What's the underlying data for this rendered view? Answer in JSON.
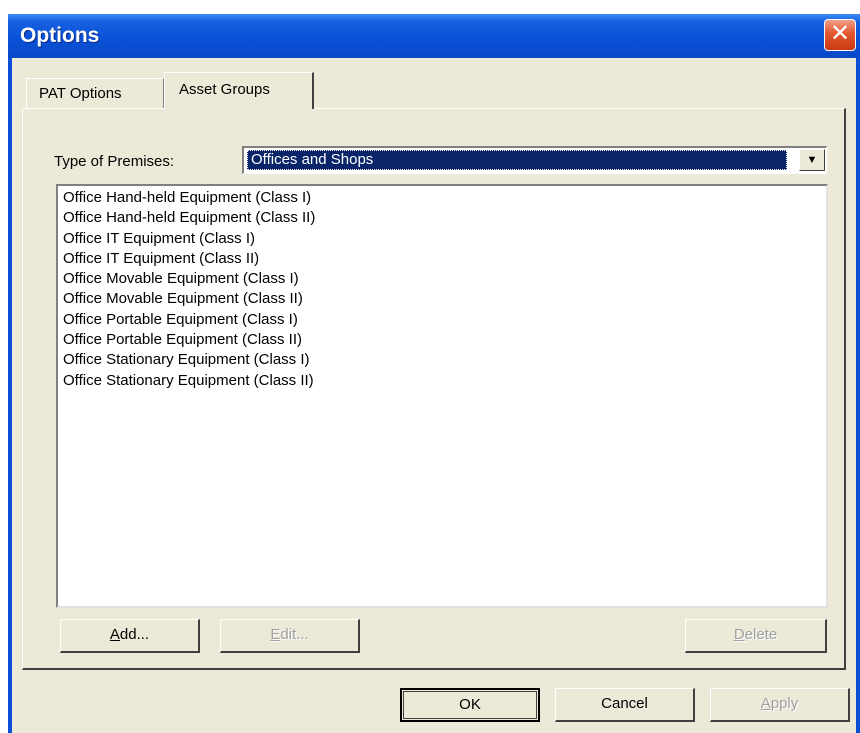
{
  "window": {
    "title": "Options"
  },
  "tabs": [
    {
      "label": "PAT Options",
      "active": false
    },
    {
      "label": "Asset Groups",
      "active": true
    }
  ],
  "premises": {
    "label": "Type of Premises:",
    "selected": "Offices and Shops"
  },
  "asset_groups": [
    "Office Hand-held Equipment (Class I)",
    "Office Hand-held Equipment (Class II)",
    "Office IT Equipment (Class I)",
    "Office IT Equipment (Class II)",
    "Office Movable Equipment (Class I)",
    "Office Movable Equipment (Class II)",
    "Office Portable Equipment (Class I)",
    "Office Portable Equipment (Class II)",
    "Office Stationary Equipment (Class I)",
    "Office Stationary Equipment (Class II)"
  ],
  "group_buttons": {
    "add": {
      "mnemonic": "A",
      "rest": "dd...",
      "enabled": true
    },
    "edit": {
      "mnemonic": "E",
      "rest": "dit...",
      "enabled": false
    },
    "delete": {
      "mnemonic": "D",
      "rest": "elete",
      "enabled": false
    }
  },
  "dialog_buttons": {
    "ok": "OK",
    "cancel": "Cancel",
    "apply": {
      "mnemonic": "A",
      "rest": "pply",
      "enabled": false
    }
  },
  "icons": {
    "close": "close-icon",
    "dropdown": "chevron-down-icon"
  },
  "colors": {
    "titlebar": "#0a50d6",
    "face": "#ece9d8",
    "selection": "#0a246a",
    "close": "#e3572c"
  }
}
